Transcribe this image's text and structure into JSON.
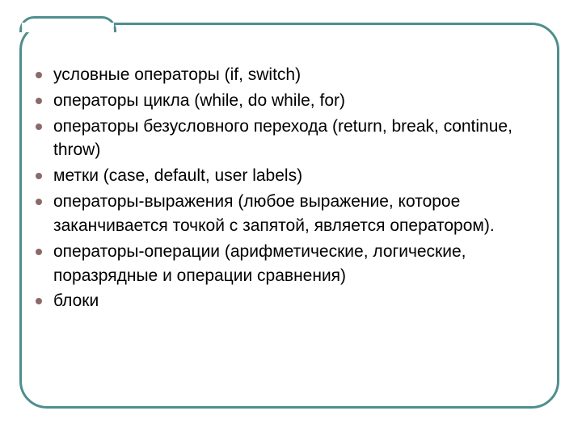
{
  "slide": {
    "bullets": [
      "условные операторы (if, switch)",
      "операторы цикла (while, do while, for)",
      "операторы безусловного перехода (return, break, continue, throw)",
      "метки (case, default, user labels)",
      "операторы-выражения (любое выражение, которое заканчивается точкой с запятой, является оператором).",
      "операторы-операции (арифметические, логические, поразрядные и операции сравнения)",
      "блоки"
    ]
  },
  "colors": {
    "frame_border": "#4f8e8e",
    "bullet_dot": "#8a6a6a",
    "text": "#000000",
    "background": "#ffffff"
  }
}
